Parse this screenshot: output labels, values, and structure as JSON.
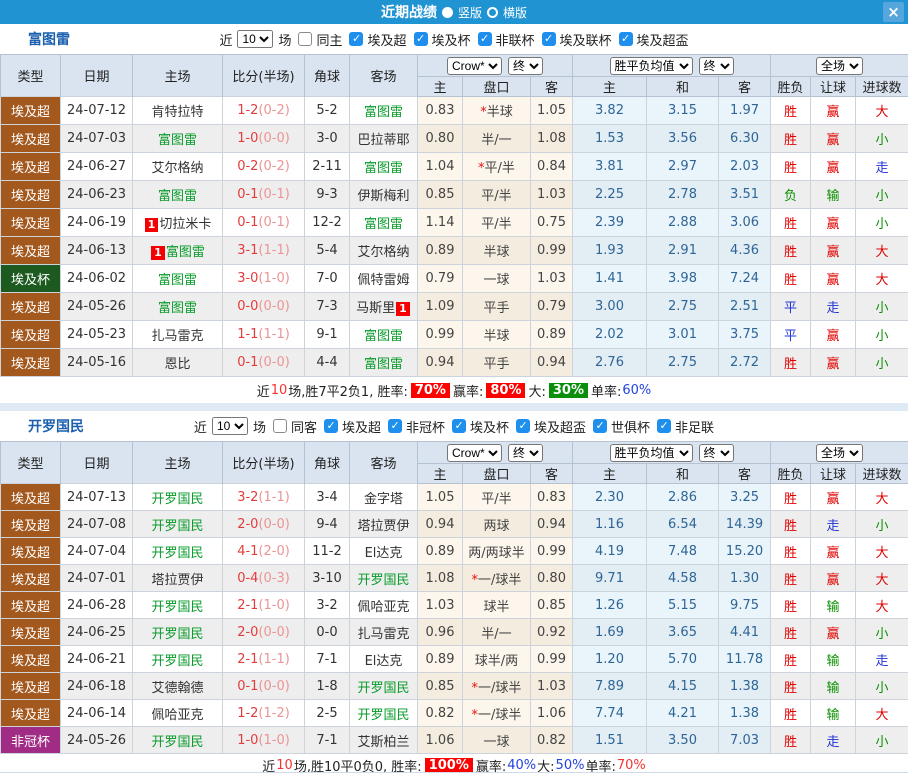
{
  "titlebar": {
    "title": "近期战绩",
    "vertical_label": "竖版",
    "horizontal_label": "横版",
    "selected_layout": "竖版",
    "close_glyph": "×"
  },
  "colors": {
    "titlebar_bg": "#2094d3",
    "type_egypt_super": "#a3581e",
    "type_egypt_cup": "#1d5a20",
    "type_nonchamp_cup": "#a02c86",
    "focal_team_green": "#089b2a",
    "win_red": "#e10000",
    "draw_blue": "#2234d6",
    "lose_green": "#0a9000"
  },
  "table_header": {
    "cols": [
      "类型",
      "日期",
      "主场",
      "比分(半场)",
      "角球",
      "客场"
    ],
    "sub": [
      "主",
      "盘口",
      "客",
      "主",
      "和",
      "客",
      "胜负",
      "让球",
      "进球数"
    ],
    "selects": {
      "odds_source": "Crow*",
      "odds_time": "终",
      "europe_label": "胜平负均值",
      "europe_time": "终",
      "scope": "全场"
    }
  },
  "type_colors": {
    "埃及超": "#a3581e",
    "埃及杯": "#1d5a20",
    "非冠杯": "#a02c86"
  },
  "sections": [
    {
      "team": "富图雷",
      "filter": {
        "near": "近",
        "count": "10",
        "unit": "场",
        "same": "同主",
        "same_checked": false,
        "leagues": [
          "埃及超",
          "埃及杯",
          "非联杯",
          "埃及联杯",
          "埃及超盃"
        ]
      },
      "rows": [
        {
          "type": "埃及超",
          "date": "24-07-12",
          "home": "肯特拉特",
          "hcard": "",
          "hfocal": false,
          "score": "1-2",
          "half": "(0-2)",
          "corner": "5-2",
          "away": "富图雷",
          "acard": "",
          "afocal": true,
          "crow_h": "0.83",
          "handicap": "*半球",
          "crow_a": "1.05",
          "eu_h": "3.82",
          "eu_d": "3.15",
          "eu_a": "1.97",
          "result": "胜",
          "let": "赢",
          "goal": "大"
        },
        {
          "type": "埃及超",
          "date": "24-07-03",
          "home": "富图雷",
          "hcard": "",
          "hfocal": true,
          "score": "1-0",
          "half": "(0-0)",
          "corner": "3-0",
          "away": "巴拉蒂耶",
          "acard": "",
          "afocal": false,
          "crow_h": "0.80",
          "handicap": "半/一",
          "crow_a": "1.08",
          "eu_h": "1.53",
          "eu_d": "3.56",
          "eu_a": "6.30",
          "result": "胜",
          "let": "赢",
          "goal": "小"
        },
        {
          "type": "埃及超",
          "date": "24-06-27",
          "home": "艾尔格纳",
          "hcard": "",
          "hfocal": false,
          "score": "0-2",
          "half": "(0-2)",
          "corner": "2-11",
          "away": "富图雷",
          "acard": "",
          "afocal": true,
          "crow_h": "1.04",
          "handicap": "*平/半",
          "crow_a": "0.84",
          "eu_h": "3.81",
          "eu_d": "2.97",
          "eu_a": "2.03",
          "result": "胜",
          "let": "赢",
          "goal": "走"
        },
        {
          "type": "埃及超",
          "date": "24-06-23",
          "home": "富图雷",
          "hcard": "",
          "hfocal": true,
          "score": "0-1",
          "half": "(0-1)",
          "corner": "9-3",
          "away": "伊斯梅利",
          "acard": "",
          "afocal": false,
          "crow_h": "0.85",
          "handicap": "平/半",
          "crow_a": "1.03",
          "eu_h": "2.25",
          "eu_d": "2.78",
          "eu_a": "3.51",
          "result": "负",
          "let": "输",
          "goal": "小"
        },
        {
          "type": "埃及超",
          "date": "24-06-19",
          "home": "切拉米卡",
          "hcard": "1",
          "hfocal": false,
          "score": "0-1",
          "half": "(0-1)",
          "corner": "12-2",
          "away": "富图雷",
          "acard": "",
          "afocal": true,
          "crow_h": "1.14",
          "handicap": "平/半",
          "crow_a": "0.75",
          "eu_h": "2.39",
          "eu_d": "2.88",
          "eu_a": "3.06",
          "result": "胜",
          "let": "赢",
          "goal": "小"
        },
        {
          "type": "埃及超",
          "date": "24-06-13",
          "home": "富图雷",
          "hcard": "1",
          "hfocal": true,
          "score": "3-1",
          "half": "(1-1)",
          "corner": "5-4",
          "away": "艾尔格纳",
          "acard": "",
          "afocal": false,
          "crow_h": "0.89",
          "handicap": "半球",
          "crow_a": "0.99",
          "eu_h": "1.93",
          "eu_d": "2.91",
          "eu_a": "4.36",
          "result": "胜",
          "let": "赢",
          "goal": "大"
        },
        {
          "type": "埃及杯",
          "date": "24-06-02",
          "home": "富图雷",
          "hcard": "",
          "hfocal": true,
          "score": "3-0",
          "half": "(1-0)",
          "corner": "7-0",
          "away": "佩特雷姆",
          "acard": "",
          "afocal": false,
          "crow_h": "0.79",
          "handicap": "一球",
          "crow_a": "1.03",
          "eu_h": "1.41",
          "eu_d": "3.98",
          "eu_a": "7.24",
          "result": "胜",
          "let": "赢",
          "goal": "大"
        },
        {
          "type": "埃及超",
          "date": "24-05-26",
          "home": "富图雷",
          "hcard": "",
          "hfocal": true,
          "score": "0-0",
          "half": "(0-0)",
          "corner": "7-3",
          "away": "马斯里",
          "acard": "1",
          "afocal": false,
          "crow_h": "1.09",
          "handicap": "平手",
          "crow_a": "0.79",
          "eu_h": "3.00",
          "eu_d": "2.75",
          "eu_a": "2.51",
          "result": "平",
          "let": "走",
          "goal": "小"
        },
        {
          "type": "埃及超",
          "date": "24-05-23",
          "home": "扎马雷克",
          "hcard": "",
          "hfocal": false,
          "score": "1-1",
          "half": "(1-1)",
          "corner": "9-1",
          "away": "富图雷",
          "acard": "",
          "afocal": true,
          "crow_h": "0.99",
          "handicap": "半球",
          "crow_a": "0.89",
          "eu_h": "2.02",
          "eu_d": "3.01",
          "eu_a": "3.75",
          "result": "平",
          "let": "赢",
          "goal": "小"
        },
        {
          "type": "埃及超",
          "date": "24-05-16",
          "home": "恩比",
          "hcard": "",
          "hfocal": false,
          "score": "0-1",
          "half": "(0-0)",
          "corner": "4-4",
          "away": "富图雷",
          "acard": "",
          "afocal": true,
          "crow_h": "0.94",
          "handicap": "平手",
          "crow_a": "0.94",
          "eu_h": "2.76",
          "eu_d": "2.75",
          "eu_a": "2.72",
          "result": "胜",
          "let": "赢",
          "goal": "小"
        }
      ],
      "footer": [
        {
          "t": "近"
        },
        {
          "t": "10",
          "c": "rtx"
        },
        {
          "t": "场,胜7平2负1, 胜率:"
        },
        {
          "t": "70%",
          "c": "rbg"
        },
        {
          "t": " 赢率:"
        },
        {
          "t": "80%",
          "c": "rbg"
        },
        {
          "t": " 大:"
        },
        {
          "t": "30%",
          "c": "gbg"
        },
        {
          "t": " 单率:"
        },
        {
          "t": "60%",
          "c": "btx"
        }
      ]
    },
    {
      "team": "开罗国民",
      "filter": {
        "near": "近",
        "count": "10",
        "unit": "场",
        "same": "同客",
        "same_checked": false,
        "leagues": [
          "埃及超",
          "非冠杯",
          "埃及杯",
          "埃及超盃",
          "世俱杯",
          "非足联"
        ]
      },
      "rows": [
        {
          "type": "埃及超",
          "date": "24-07-13",
          "home": "开罗国民",
          "hcard": "",
          "hfocal": true,
          "score": "3-2",
          "half": "(1-1)",
          "corner": "3-4",
          "away": "金字塔",
          "acard": "",
          "afocal": false,
          "crow_h": "1.05",
          "handicap": "平/半",
          "crow_a": "0.83",
          "eu_h": "2.30",
          "eu_d": "2.86",
          "eu_a": "3.25",
          "result": "胜",
          "let": "赢",
          "goal": "大"
        },
        {
          "type": "埃及超",
          "date": "24-07-08",
          "home": "开罗国民",
          "hcard": "",
          "hfocal": true,
          "score": "2-0",
          "half": "(0-0)",
          "corner": "9-4",
          "away": "塔拉贾伊",
          "acard": "",
          "afocal": false,
          "crow_h": "0.94",
          "handicap": "两球",
          "crow_a": "0.94",
          "eu_h": "1.16",
          "eu_d": "6.54",
          "eu_a": "14.39",
          "result": "胜",
          "let": "走",
          "goal": "小"
        },
        {
          "type": "埃及超",
          "date": "24-07-04",
          "home": "开罗国民",
          "hcard": "",
          "hfocal": true,
          "score": "4-1",
          "half": "(2-0)",
          "corner": "11-2",
          "away": "El达克",
          "acard": "",
          "afocal": false,
          "crow_h": "0.89",
          "handicap": "两/两球半",
          "crow_a": "0.99",
          "eu_h": "4.19",
          "eu_d": "7.48",
          "eu_a": "15.20",
          "result": "胜",
          "let": "赢",
          "goal": "大"
        },
        {
          "type": "埃及超",
          "date": "24-07-01",
          "home": "塔拉贾伊",
          "hcard": "",
          "hfocal": false,
          "score": "0-4",
          "half": "(0-3)",
          "corner": "3-10",
          "away": "开罗国民",
          "acard": "",
          "afocal": true,
          "crow_h": "1.08",
          "handicap": "*一/球半",
          "crow_a": "0.80",
          "eu_h": "9.71",
          "eu_d": "4.58",
          "eu_a": "1.30",
          "result": "胜",
          "let": "赢",
          "goal": "大"
        },
        {
          "type": "埃及超",
          "date": "24-06-28",
          "home": "开罗国民",
          "hcard": "",
          "hfocal": true,
          "score": "2-1",
          "half": "(1-0)",
          "corner": "3-2",
          "away": "佩哈亚克",
          "acard": "",
          "afocal": false,
          "crow_h": "1.03",
          "handicap": "球半",
          "crow_a": "0.85",
          "eu_h": "1.26",
          "eu_d": "5.15",
          "eu_a": "9.75",
          "result": "胜",
          "let": "输",
          "goal": "大"
        },
        {
          "type": "埃及超",
          "date": "24-06-25",
          "home": "开罗国民",
          "hcard": "",
          "hfocal": true,
          "score": "2-0",
          "half": "(0-0)",
          "corner": "0-0",
          "away": "扎马雷克",
          "acard": "",
          "afocal": false,
          "crow_h": "0.96",
          "handicap": "半/一",
          "crow_a": "0.92",
          "eu_h": "1.69",
          "eu_d": "3.65",
          "eu_a": "4.41",
          "result": "胜",
          "let": "赢",
          "goal": "小"
        },
        {
          "type": "埃及超",
          "date": "24-06-21",
          "home": "开罗国民",
          "hcard": "",
          "hfocal": true,
          "score": "2-1",
          "half": "(1-1)",
          "corner": "7-1",
          "away": "El达克",
          "acard": "",
          "afocal": false,
          "crow_h": "0.89",
          "handicap": "球半/两",
          "crow_a": "0.99",
          "eu_h": "1.20",
          "eu_d": "5.70",
          "eu_a": "11.78",
          "result": "胜",
          "let": "输",
          "goal": "走"
        },
        {
          "type": "埃及超",
          "date": "24-06-18",
          "home": "艾德翰德",
          "hcard": "",
          "hfocal": false,
          "score": "0-1",
          "half": "(0-0)",
          "corner": "1-8",
          "away": "开罗国民",
          "acard": "",
          "afocal": true,
          "crow_h": "0.85",
          "handicap": "*一/球半",
          "crow_a": "1.03",
          "eu_h": "7.89",
          "eu_d": "4.15",
          "eu_a": "1.38",
          "result": "胜",
          "let": "输",
          "goal": "小"
        },
        {
          "type": "埃及超",
          "date": "24-06-14",
          "home": "佩哈亚克",
          "hcard": "",
          "hfocal": false,
          "score": "1-2",
          "half": "(1-2)",
          "corner": "2-5",
          "away": "开罗国民",
          "acard": "",
          "afocal": true,
          "crow_h": "0.82",
          "handicap": "*一/球半",
          "crow_a": "1.06",
          "eu_h": "7.74",
          "eu_d": "4.21",
          "eu_a": "1.38",
          "result": "胜",
          "let": "输",
          "goal": "大"
        },
        {
          "type": "非冠杯",
          "date": "24-05-26",
          "home": "开罗国民",
          "hcard": "",
          "hfocal": true,
          "score": "1-0",
          "half": "(1-0)",
          "corner": "7-1",
          "away": "艾斯柏兰",
          "acard": "",
          "afocal": false,
          "crow_h": "1.06",
          "handicap": "一球",
          "crow_a": "0.82",
          "eu_h": "1.51",
          "eu_d": "3.50",
          "eu_a": "7.03",
          "result": "胜",
          "let": "走",
          "goal": "小"
        }
      ],
      "footer": [
        {
          "t": "近"
        },
        {
          "t": "10",
          "c": "rtx"
        },
        {
          "t": "场,胜10平0负0, 胜率:"
        },
        {
          "t": "100%",
          "c": "rbg"
        },
        {
          "t": " 赢率:"
        },
        {
          "t": "40%",
          "c": "btx"
        },
        {
          "t": " 大:"
        },
        {
          "t": "50%",
          "c": "btx"
        },
        {
          "t": " 单率:"
        },
        {
          "t": "70%",
          "c": "rtx"
        }
      ]
    }
  ]
}
